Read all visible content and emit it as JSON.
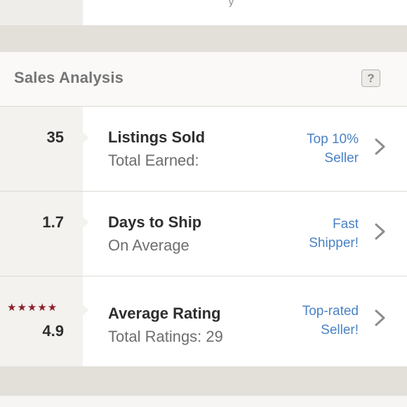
{
  "top": {
    "fragment": "y"
  },
  "sales": {
    "title": "Sales Analysis",
    "help_label": "?",
    "rows": [
      {
        "stat": "35",
        "main_label": "Listings Sold",
        "sub_label": "Total Earned:",
        "badge_line1": "Top 10%",
        "badge_line2": "Seller"
      },
      {
        "stat": "1.7",
        "main_label": "Days to Ship",
        "sub_label": "On Average",
        "badge_line1": "Fast",
        "badge_line2": "Shipper!"
      },
      {
        "stars": "★★★★★",
        "star_rating": 5,
        "stat": "4.9",
        "main_label": "Average Rating",
        "sub_label": "Total Ratings: 29",
        "badge_line1": "Top-rated",
        "badge_line2": "Seller!"
      }
    ]
  },
  "colors": {
    "accent_blue": "#4a82c4",
    "star_red": "#8c1f2a"
  },
  "icons": {
    "chevron": "chevron-right-icon",
    "help": "help-icon"
  }
}
